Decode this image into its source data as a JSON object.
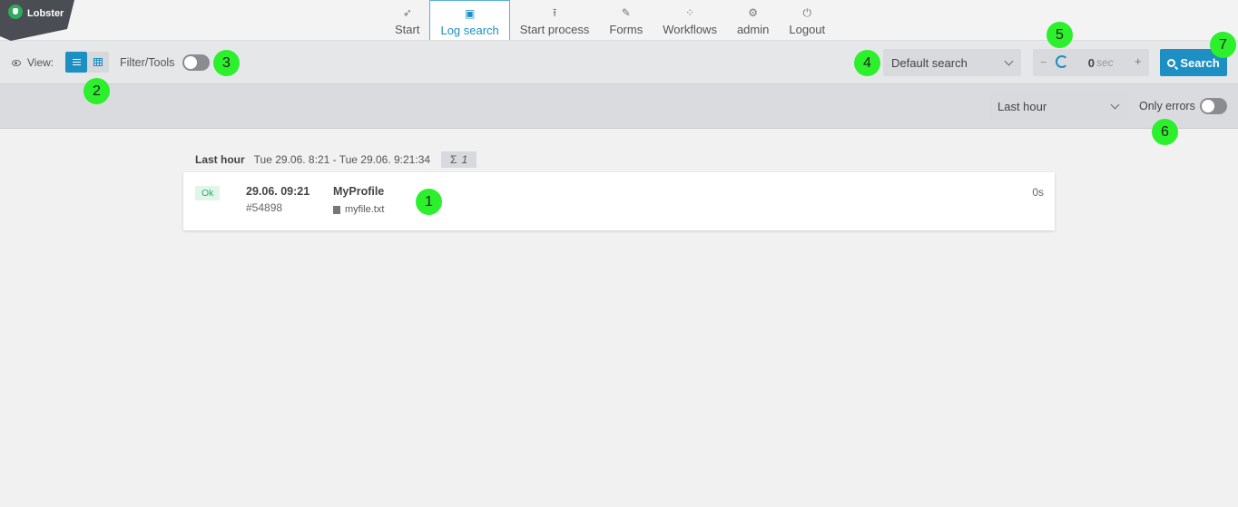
{
  "app": {
    "logo_text": "Lobster"
  },
  "nav": [
    {
      "label": "Start",
      "icon": "rocket-icon"
    },
    {
      "label": "Log search",
      "icon": "document-search-icon",
      "active": true
    },
    {
      "label": "Start process",
      "icon": "upload-icon"
    },
    {
      "label": "Forms",
      "icon": "edit-icon"
    },
    {
      "label": "Workflows",
      "icon": "workflow-icon"
    },
    {
      "label": "admin",
      "icon": "admin-user-icon"
    },
    {
      "label": "Logout",
      "icon": "power-icon"
    }
  ],
  "toolbar": {
    "view_label": "View:",
    "filter_label": "Filter/Tools",
    "search_select": "Default search",
    "refresh_value": "0",
    "refresh_unit": "sec",
    "minus": "−",
    "plus": "+",
    "search_button": "Search"
  },
  "filters": {
    "period_select": "Last hour",
    "only_errors_label": "Only errors"
  },
  "results": {
    "period": "Last hour",
    "range": "Tue 29.06. 8:21 - Tue 29.06. 9:21:34",
    "count_symbol": "Σ",
    "count": "1",
    "entries": [
      {
        "status": "Ok",
        "time": "29.06. 09:21",
        "job_id": "#54898",
        "profile": "MyProfile",
        "file": "myfile.txt",
        "duration": "0s"
      }
    ]
  },
  "markers": [
    "1",
    "2",
    "3",
    "4",
    "5",
    "6",
    "7"
  ],
  "colors": {
    "accent": "#1d8fc3",
    "ok": "#2eab5c",
    "marker": "#2bf02b"
  }
}
